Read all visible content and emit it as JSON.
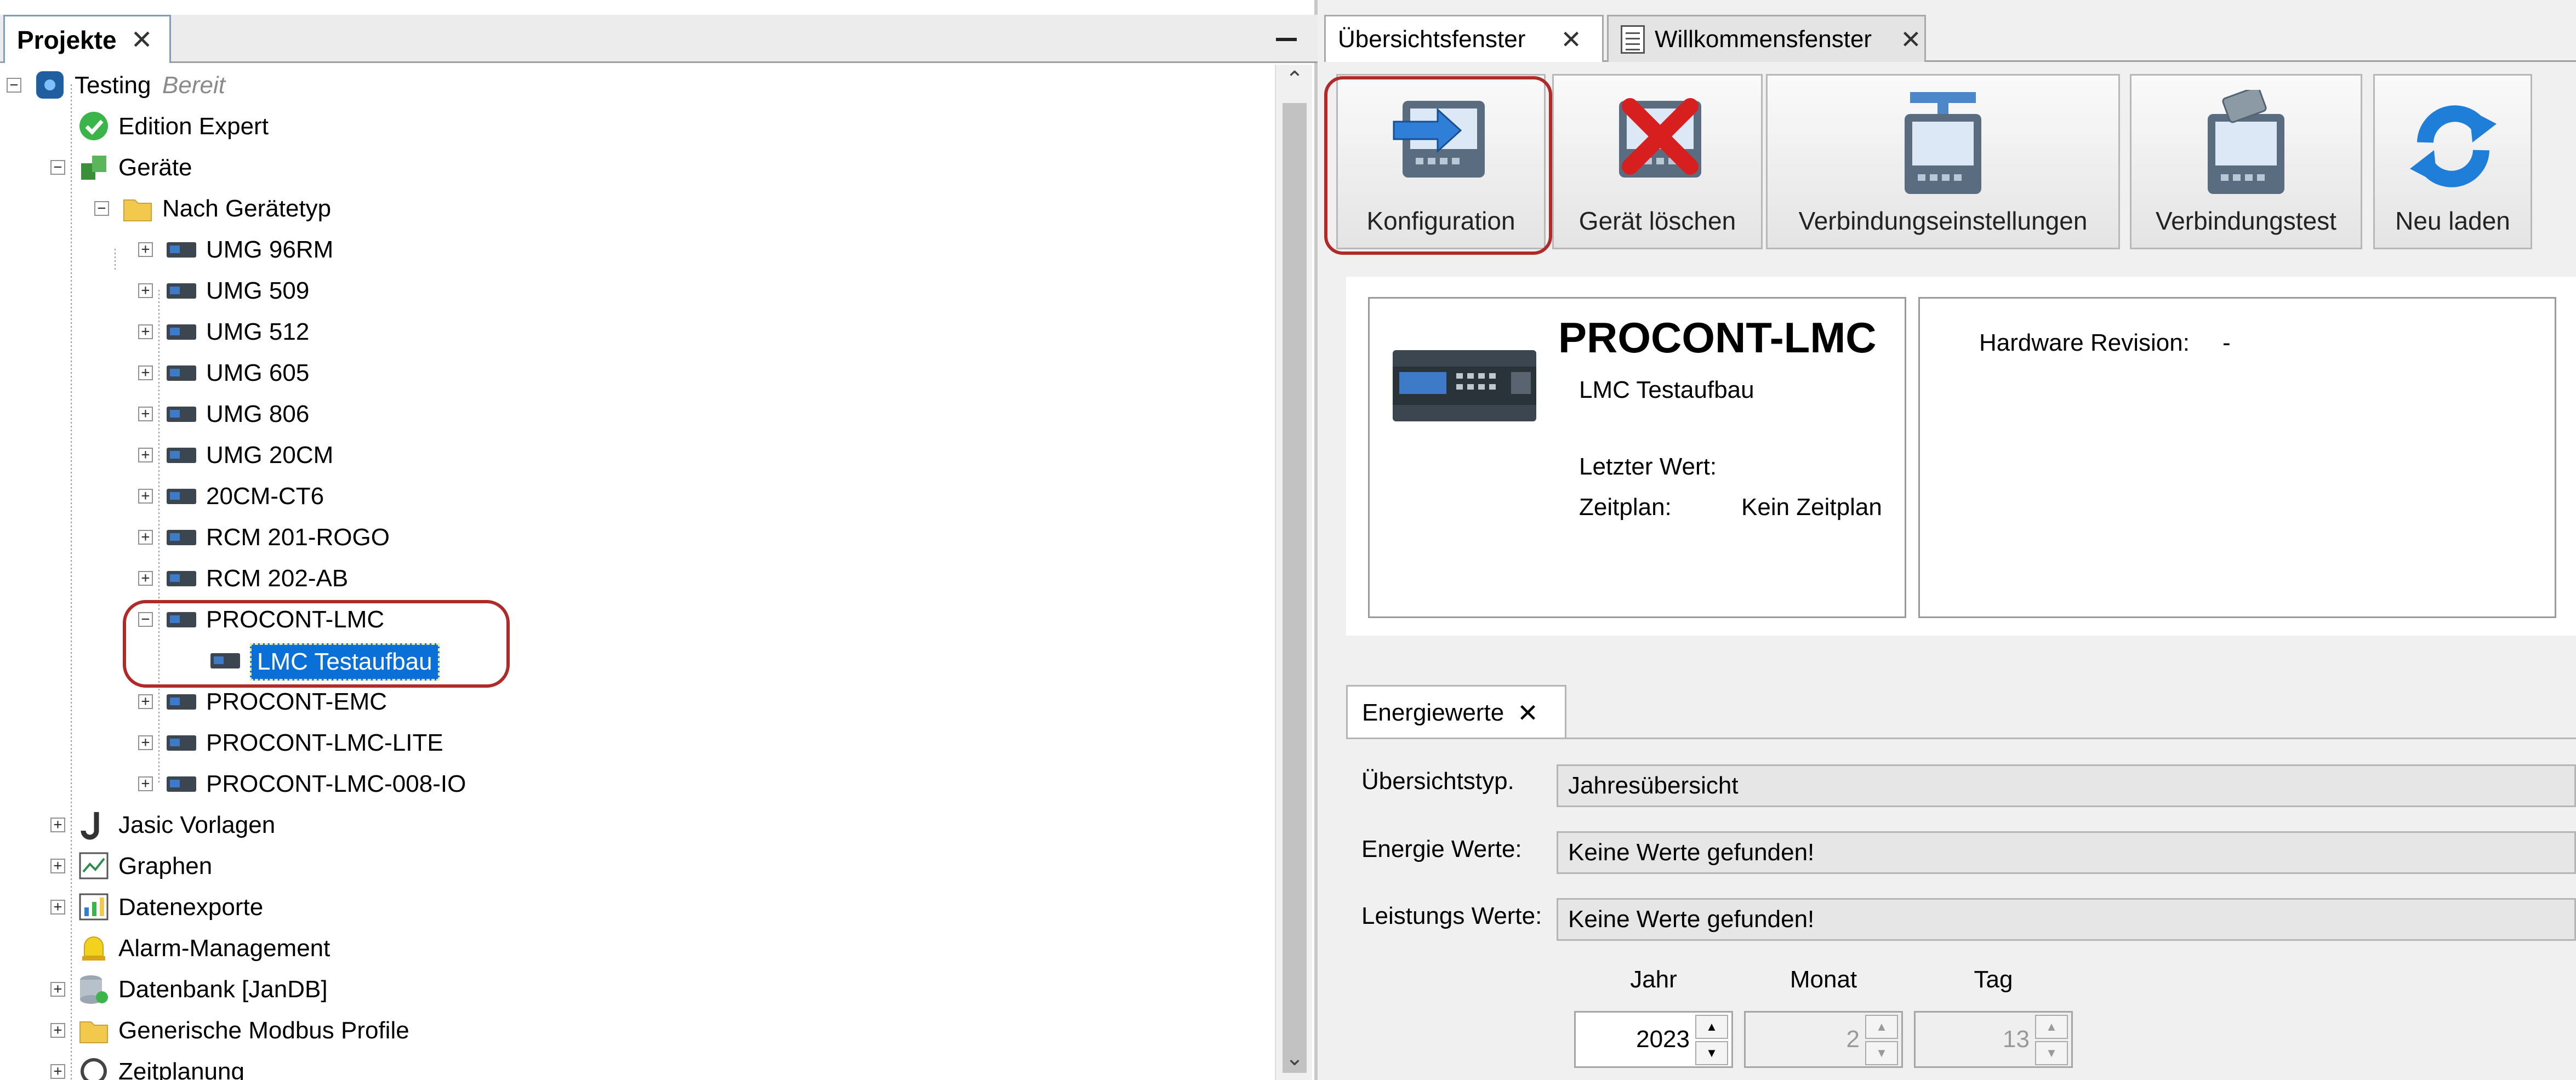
{
  "left_panel": {
    "tab_label": "Projekte",
    "close_glyph": "✕",
    "tree": {
      "root": {
        "label": "Testing",
        "status": "Bereit"
      },
      "edition": "Edition Expert",
      "devices": "Geräte",
      "by_type": "Nach Gerätetyp",
      "device_types": [
        "UMG 96RM",
        "UMG 509",
        "UMG 512",
        "UMG 605",
        "UMG 806",
        "UMG 20CM",
        "20CM-CT6",
        "RCM 201-ROGO",
        "RCM 202-AB",
        "PROCONT-LMC",
        "PROCONT-EMC",
        "PROCONT-LMC-LITE",
        "PROCONT-LMC-008-IO"
      ],
      "selected_device": "LMC Testaufbau",
      "top_level": [
        "Jasic Vorlagen",
        "Graphen",
        "Datenexporte",
        "Alarm-Management",
        "Datenbank [JanDB]",
        "Generische Modbus Profile"
      ],
      "cut_off_item": "Zeitplanung"
    }
  },
  "right_panel": {
    "tabs": [
      "Übersichtsfenster",
      "Willkommensfenster"
    ],
    "close_glyph": "✕",
    "toolbar": [
      "Konfiguration",
      "Gerät löschen",
      "Verbindungseinstellungen",
      "Verbindungstest",
      "Neu laden"
    ],
    "device": {
      "title": "PROCONT-LMC",
      "name": "LMC Testaufbau",
      "last_value_label": "Letzter Wert:",
      "schedule_label": "Zeitplan:",
      "schedule_value": "Kein Zeitplan",
      "hw_label": "Hardware Revision:",
      "hw_value": "-"
    },
    "energy": {
      "tab_label": "Energiewerte",
      "overview_type_label": "Übersichtstyp.",
      "overview_type_value": "Jahresübersicht",
      "energy_values_label": "Energie Werte:",
      "energy_values_value": "Keine Werte gefunden!",
      "power_values_label": "Leistungs Werte:",
      "power_values_value": "Keine Werte gefunden!",
      "year_label": "Jahr",
      "month_label": "Monat",
      "day_label": "Tag",
      "year": "2023",
      "month": "2",
      "day": "13"
    }
  },
  "colors": {
    "selection": "#0a6fd6",
    "annotation_ring": "#b02a2a"
  }
}
